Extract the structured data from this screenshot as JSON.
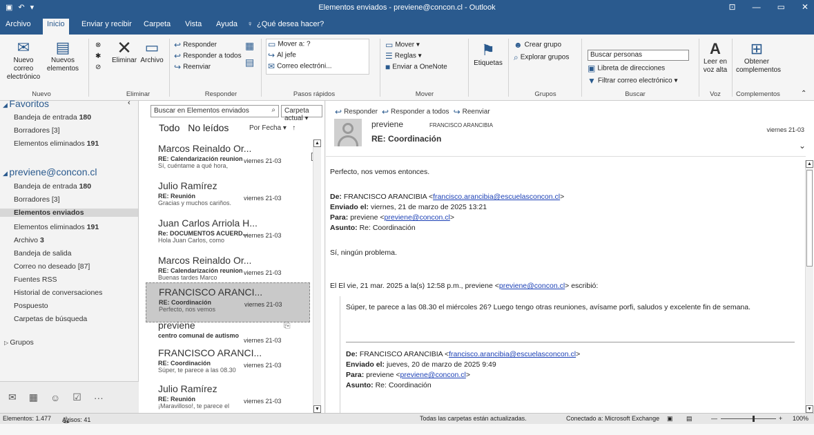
{
  "window": {
    "title": "Elementos enviados - previene@concon.cl - Outlook",
    "controls": [
      "⊡",
      "—",
      "▭",
      "✕"
    ]
  },
  "ribbon_tabs": [
    {
      "label": "Archivo"
    },
    {
      "label": "Inicio"
    },
    {
      "label": "Enviar y recibir"
    },
    {
      "label": "Carpeta"
    },
    {
      "label": "Vista"
    },
    {
      "label": "Ayuda"
    },
    {
      "label": "¿Qué desea hacer?"
    }
  ],
  "ribbon": {
    "nuevo": {
      "new_email": "Nuevo correo electrónico",
      "new_items": "Nuevos elementos",
      "group": "Nuevo"
    },
    "eliminar": {
      "delete": "Eliminar",
      "archive": "Archivo",
      "group": "Eliminar"
    },
    "responder": {
      "reply": "Responder",
      "reply_all": "Responder a todos",
      "forward": "Reenviar",
      "group": "Responder"
    },
    "pasos": {
      "move_to": "Mover a: ?",
      "to_boss": "Al jefe",
      "email": "Correo electróni...",
      "group": "Pasos rápidos"
    },
    "mover": {
      "move": "Mover",
      "rules": "Reglas",
      "onenote": "Enviar a OneNote",
      "group": "Mover"
    },
    "etiquetas": {
      "label": "Etiquetas"
    },
    "grupos": {
      "create": "Crear grupo",
      "explore": "Explorar grupos",
      "group": "Grupos"
    },
    "buscar": {
      "search_people": "Buscar personas",
      "address_book": "Libreta de direcciones",
      "filter": "Filtrar correo electrónico",
      "group": "Buscar"
    },
    "voz": {
      "read_aloud": "Leer en voz alta",
      "group": "Voz"
    },
    "complementos": {
      "get_addins": "Obtener complementos",
      "group": "Complementos"
    }
  },
  "nav": {
    "favorites_header": "Favoritos",
    "favorites": [
      {
        "label": "Bandeja de entrada",
        "count": "180"
      },
      {
        "label": "Borradores [3]",
        "count": ""
      },
      {
        "label": "Elementos eliminados",
        "count": "191"
      }
    ],
    "account": "previene@concon.cl",
    "folders": [
      {
        "label": "Bandeja de entrada",
        "count": "180"
      },
      {
        "label": "Borradores [3]",
        "count": ""
      },
      {
        "label": "Elementos enviados",
        "count": ""
      },
      {
        "label": "Elementos eliminados",
        "count": "191"
      },
      {
        "label": "Archivo",
        "count": "3"
      },
      {
        "label": "Bandeja de salida",
        "count": ""
      },
      {
        "label": "Correo no deseado [87]",
        "count": ""
      },
      {
        "label": "Fuentes RSS",
        "count": ""
      },
      {
        "label": "Historial de conversaciones",
        "count": ""
      },
      {
        "label": "Pospuesto",
        "count": ""
      },
      {
        "label": "Carpetas de búsqueda",
        "count": ""
      }
    ],
    "groups": "Grupos"
  },
  "list": {
    "search_placeholder": "Buscar en Elementos enviados",
    "scope": "Carpeta actual",
    "tab_all": "Todo",
    "tab_unread": "No leídos",
    "sort": "Por Fecha",
    "messages": [
      {
        "from": "Marcos Reinaldo Or...",
        "subject": "RE: Calendarización reunion",
        "preview": "Sí, cuéntame a qué hora,",
        "date": "viernes 21-03"
      },
      {
        "from": "Julio Ramírez",
        "subject": "RE: Reunión",
        "preview": "Gracias y muchos cariños.",
        "date": "viernes 21-03"
      },
      {
        "from": "Juan Carlos Arriola H...",
        "subject": "Re: DOCUMENTOS ACUERD...",
        "preview": "Hola Juan Carlos, como",
        "date": "viernes 21-03"
      },
      {
        "from": "Marcos Reinaldo Or...",
        "subject": "RE: Calendarización reunion",
        "preview": "Buenas tardes Marco",
        "date": "viernes 21-03"
      },
      {
        "from": "FRANCISCO ARANCI...",
        "subject": "RE: Coordinación",
        "preview": "Perfecto, nos vemos",
        "date": "viernes 21-03"
      },
      {
        "from": "previene",
        "subject": "centro comunal de autismo",
        "preview": "",
        "date": "viernes 21-03"
      },
      {
        "from": "FRANCISCO ARANCI...",
        "subject": "RE: Coordinación",
        "preview": "Súper, te parece a las 08.30",
        "date": "viernes 21-03"
      },
      {
        "from": "Julio Ramírez",
        "subject": "RE: Reunión",
        "preview": "¡Maravilloso!, te parece el",
        "date": "viernes 21-03"
      }
    ]
  },
  "reading": {
    "reply": "Responder",
    "reply_all": "Responder a todos",
    "forward": "Reenviar",
    "sender": "previene",
    "to": "FRANCISCO ARANCIBIA",
    "subject": "RE: Coordinación",
    "date": "viernes 21-03",
    "body_text": "Perfecto, nos vemos entonces.",
    "header1": {
      "from_label": "De:",
      "from_name": "FRANCISCO ARANCIBIA",
      "from_email": "francisco.arancibia@escuelasconcon.cl",
      "sent_label": "Enviado el:",
      "sent": "viernes, 21 de marzo de 2025 13:21",
      "to_label": "Para:",
      "to_name": "previene",
      "to_email": "previene@concon.cl",
      "subject_label": "Asunto:",
      "subject": "Re: Coordinación"
    },
    "reply_text": "Sí, ningún problema.",
    "quote_intro": "El El vie, 21 mar. 2025 a la(s) 12:58 p.m., previene",
    "quote_email": "previene@concon.cl",
    "quote_suffix": "escribió:",
    "quoted_text": "Súper, te parece a las 08.30 el miércoles 26? Luego tengo otras reuniones, avísame porfi, saludos y excelente fin de semana.",
    "header2": {
      "from_label": "De:",
      "from_name": "FRANCISCO ARANCIBIA",
      "from_email": "francisco.arancibia@escuelasconcon.cl",
      "sent_label": "Enviado el:",
      "sent": "jueves, 20 de marzo de 2025 9:49",
      "to_label": "Para:",
      "to_name": "previene",
      "to_email": "previene@concon.cl",
      "subject_label": "Asunto:",
      "subject": "Re: Coordinación"
    }
  },
  "status": {
    "items": "Elementos: 1.477",
    "reminders": "Avisos: 41",
    "sync": "Todas las carpetas están actualizadas.",
    "connection": "Conectado a: Microsoft Exchange",
    "zoom": "100%"
  },
  "colors": {
    "accent": "#2a5a8e",
    "link": "#1a3fb5",
    "selected": "#c9c9c9"
  }
}
